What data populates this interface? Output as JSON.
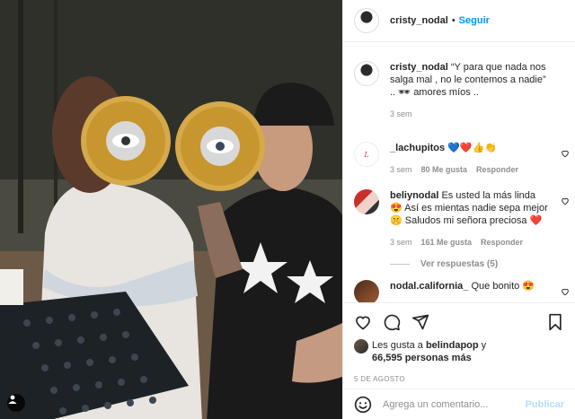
{
  "post": {
    "username": "cristy_nodal",
    "dot": "•",
    "follow_label": "Seguir"
  },
  "comments": [
    {
      "username": "cristy_nodal",
      "text": "“Y para que nada nos salga mal , no le contemos a nadie” .. 🕶 amores míos ..",
      "time": "3 sem"
    },
    {
      "username": "_lachupitos",
      "text": "💙❤️👍👏",
      "time": "3 sem",
      "likes": "80 Me gusta",
      "reply": "Responder"
    },
    {
      "username": "beliynodal",
      "text": "Es usted la más linda 😍 Así es mientas nadie sepa mejor 🤫 Saludos mi señora preciosa ❤️",
      "time": "3 sem",
      "likes": "161 Me gusta",
      "reply": "Responder",
      "view_replies": "Ver respuestas (5)"
    },
    {
      "username": "nodal.california_",
      "text": "Que bonito 😍"
    }
  ],
  "likes": {
    "prefix": "Les gusta a ",
    "user": "belindapop",
    "suffix": " y",
    "count": "66,595 personas más"
  },
  "date": "5 DE AGOSTO",
  "add_comment": {
    "placeholder": "Agrega un comentario...",
    "publish_label": "Publicar"
  },
  "icons": [
    "heart-icon",
    "comment-icon",
    "share-icon",
    "bookmark-icon",
    "smile-icon",
    "user-tag-icon"
  ]
}
